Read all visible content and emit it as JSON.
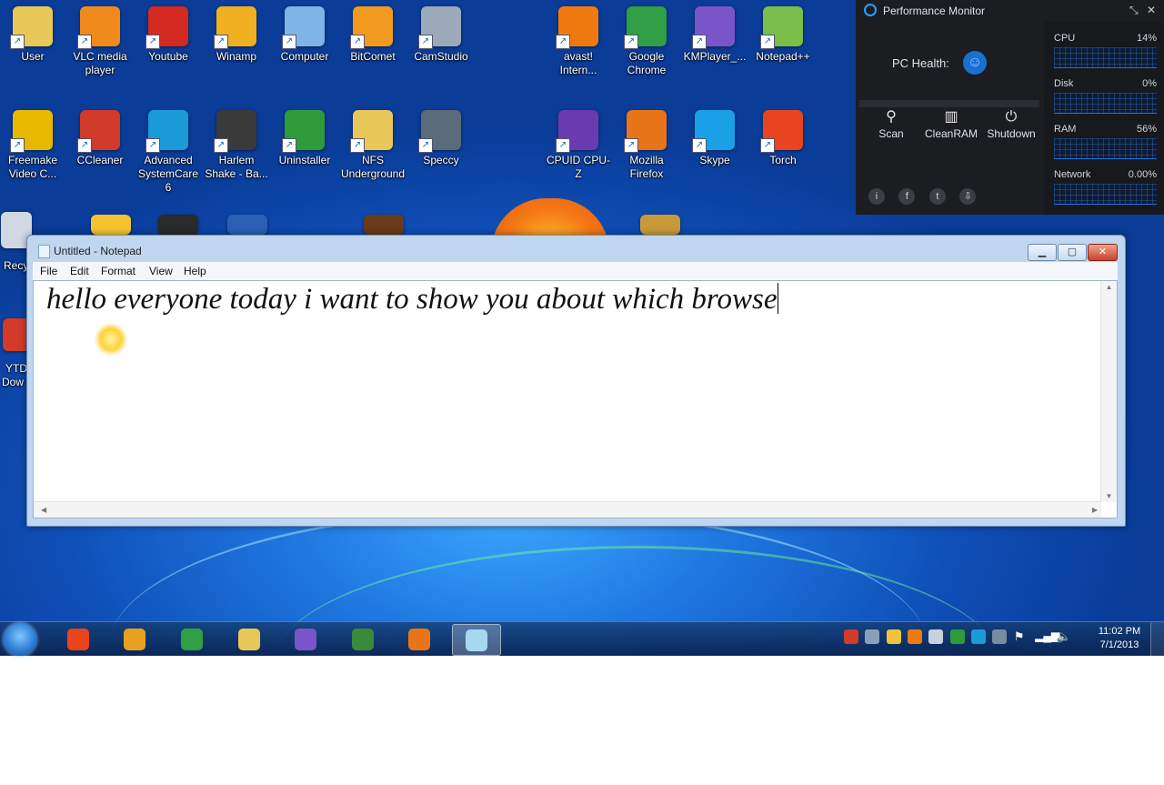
{
  "desktop": {
    "icons_row1": [
      {
        "label": "User",
        "icon": "user-folder-icon",
        "color": "#e9c85a"
      },
      {
        "label": "VLC media player",
        "icon": "vlc-icon",
        "color": "#f08a1c"
      },
      {
        "label": "Youtube",
        "icon": "youtube-icon",
        "color": "#d42a22"
      },
      {
        "label": "Winamp",
        "icon": "winamp-icon",
        "color": "#f0b020"
      },
      {
        "label": "Computer",
        "icon": "computer-icon",
        "color": "#7fb4e6"
      },
      {
        "label": "BitComet",
        "icon": "bitcomet-icon",
        "color": "#f29a1f"
      },
      {
        "label": "CamStudio",
        "icon": "camstudio-icon",
        "color": "#9ca9b9"
      },
      {
        "label": "avast! Intern...",
        "icon": "avast-icon",
        "color": "#f07a10"
      },
      {
        "label": "Google Chrome",
        "icon": "chrome-icon",
        "color": "#2f9e44"
      },
      {
        "label": "KMPlayer_...",
        "icon": "kmplayer-icon",
        "color": "#7a55c9"
      },
      {
        "label": "Notepad++",
        "icon": "notepadpp-icon",
        "color": "#78c04a"
      }
    ],
    "icons_row2": [
      {
        "label": "Freemake Video C...",
        "icon": "freemake-icon",
        "color": "#e6b800"
      },
      {
        "label": "CCleaner",
        "icon": "ccleaner-icon",
        "color": "#d23a2a"
      },
      {
        "label": "Advanced SystemCare 6",
        "icon": "systemcare-icon",
        "color": "#1a9bd8"
      },
      {
        "label": "Harlem Shake - Ba...",
        "icon": "video-file-icon",
        "color": "#3a3a3a"
      },
      {
        "label": "Uninstaller",
        "icon": "uninstaller-icon",
        "color": "#2d9b3a"
      },
      {
        "label": "NFS Underground",
        "icon": "folder-icon",
        "color": "#e9c85a"
      },
      {
        "label": "Speccy",
        "icon": "speccy-icon",
        "color": "#5a6b7a"
      },
      {
        "label": "CPUID CPU-Z",
        "icon": "cpuz-icon",
        "color": "#6a3ab0"
      },
      {
        "label": "Mozilla Firefox",
        "icon": "firefox-icon",
        "color": "#e8751a"
      },
      {
        "label": "Skype",
        "icon": "skype-icon",
        "color": "#1aa0e6"
      },
      {
        "label": "Torch",
        "icon": "torch-icon",
        "color": "#e8441e"
      }
    ],
    "partial_labels": {
      "recycle": "Recy",
      "ytd_1": "YTD",
      "ytd_2": "Dow"
    }
  },
  "perf_monitor": {
    "title": "Performance Monitor",
    "pc_health_label": "PC Health:",
    "tools": [
      {
        "label": "Scan",
        "icon": "search-icon"
      },
      {
        "label": "CleanRAM",
        "icon": "ram-icon"
      },
      {
        "label": "Shutdown",
        "icon": "power-icon"
      }
    ],
    "social": [
      "info-icon",
      "facebook-icon",
      "twitter-icon",
      "download-icon"
    ],
    "meters": [
      {
        "label": "CPU",
        "value": "14%",
        "level": 0.14
      },
      {
        "label": "Disk",
        "value": "0%",
        "level": 0.0
      },
      {
        "label": "RAM",
        "value": "56%",
        "level": 0.56
      },
      {
        "label": "Network",
        "value": "0.00%",
        "level": 0.0
      }
    ]
  },
  "notepad": {
    "title": "Untitled - Notepad",
    "menu": [
      "File",
      "Edit",
      "Format",
      "View",
      "Help"
    ],
    "content": "hello everyone today i want to show you about which browse"
  },
  "taskbar": {
    "pinned": [
      {
        "icon": "torch-icon",
        "color": "#e8441e"
      },
      {
        "icon": "media-player-icon",
        "color": "#e8a020"
      },
      {
        "icon": "chrome-icon",
        "color": "#2f9e44"
      },
      {
        "icon": "explorer-icon",
        "color": "#e9c85a"
      },
      {
        "icon": "kmplayer-icon",
        "color": "#7a55c9"
      },
      {
        "icon": "screen-recorder-icon",
        "color": "#3a8a3a"
      },
      {
        "icon": "firefox-icon",
        "color": "#e8751a"
      },
      {
        "icon": "notepad-icon",
        "color": "#a8d8f0"
      }
    ],
    "clock_time": "11:02 PM",
    "clock_date": "7/1/2013"
  }
}
